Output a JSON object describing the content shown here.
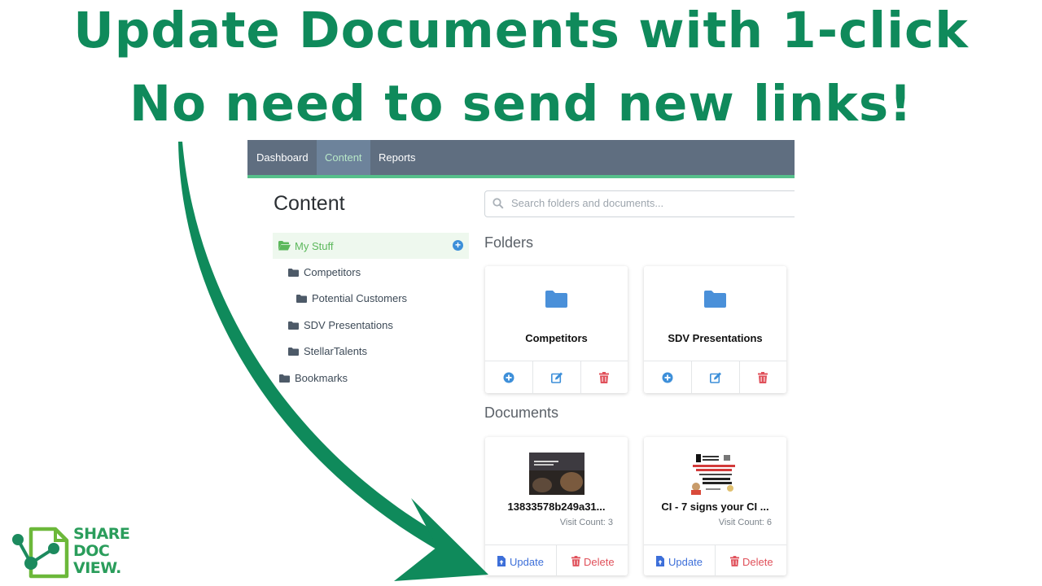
{
  "headline": {
    "line1": "Update Documents with 1-click",
    "line2": "No need to send new links!"
  },
  "nav": {
    "items": [
      {
        "label": "Dashboard",
        "active": false
      },
      {
        "label": "Content",
        "active": true
      },
      {
        "label": "Reports",
        "active": false
      }
    ]
  },
  "page_title": "Content",
  "search": {
    "placeholder": "Search folders and documents..."
  },
  "tree": {
    "root": {
      "label": "My Stuff",
      "icon": "folder-open-icon"
    },
    "children": [
      {
        "label": "Competitors"
      },
      {
        "label": "Potential Customers"
      },
      {
        "label": "SDV Presentations"
      },
      {
        "label": "StellarTalents"
      }
    ],
    "bookmarks": {
      "label": "Bookmarks"
    }
  },
  "folders": {
    "heading": "Folders",
    "items": [
      {
        "name": "Competitors"
      },
      {
        "name": "SDV Presentations"
      }
    ]
  },
  "documents": {
    "heading": "Documents",
    "items": [
      {
        "name": "13833578b249a31...",
        "visit_count": "Visit Count: 3",
        "update_label": "Update",
        "delete_label": "Delete"
      },
      {
        "name": "CI - 7 signs your CI ...",
        "visit_count": "Visit Count: 6",
        "update_label": "Update",
        "delete_label": "Delete"
      }
    ]
  },
  "logo": {
    "line1": "SHARE",
    "line2": "DOC",
    "line3": "VIEW."
  },
  "colors": {
    "headline_green": "#0f8a5b",
    "nav_bg": "#5f6e80",
    "nav_accent": "#56c08b",
    "blue_icon": "#3d8fd9",
    "delete_red": "#e0505a"
  }
}
